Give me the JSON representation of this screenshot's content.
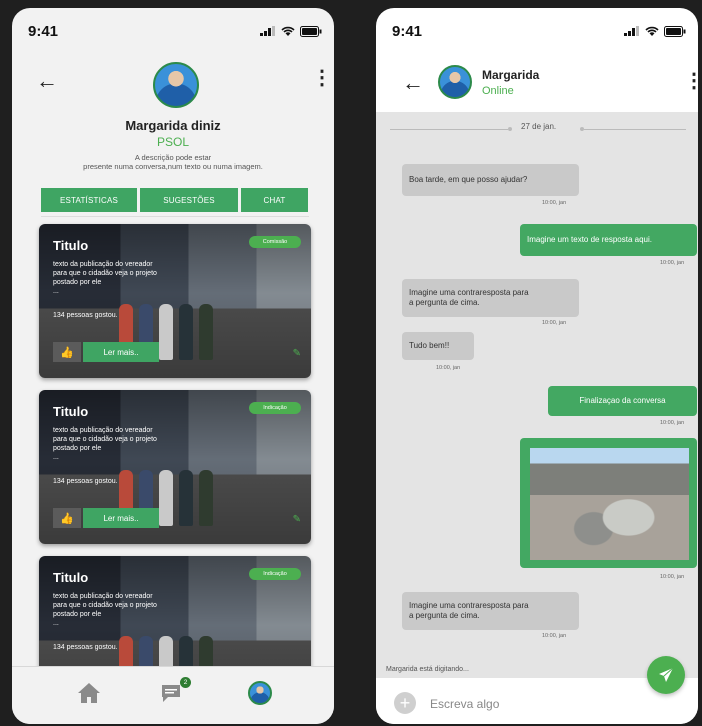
{
  "status_bar": {
    "time": "9:41"
  },
  "profile": {
    "name": "Margarida diniz",
    "party": "PSOL",
    "description_line1": "A descrição pode estar",
    "description_line2": "presente numa conversa,num texto ou numa imagem."
  },
  "tabs": [
    {
      "label": "ESTATÍSTICAS"
    },
    {
      "label": "SUGESTÕES"
    },
    {
      "label": "CHAT"
    }
  ],
  "posts": [
    {
      "title": "Titulo",
      "text_line1": "texto da publicação do vereador",
      "text_line2": "para que o cidadão veja o projeto",
      "text_line3": "postado por ele",
      "text_line4": "...",
      "likes": "134 pessoas gostou.",
      "badge": "Comissão",
      "button": "Ler mais.."
    },
    {
      "title": "Titulo",
      "text_line1": "texto da publicação do vereador",
      "text_line2": "para que o cidadão veja o projeto",
      "text_line3": "postado por ele",
      "text_line4": "...",
      "likes": "134 pessoas gostou.",
      "badge": "Indicação",
      "button": "Ler mais.."
    },
    {
      "title": "Titulo",
      "text_line1": "texto da publicação do vereador",
      "text_line2": "para que o cidadão veja o projeto",
      "text_line3": "postado por ele",
      "text_line4": "...",
      "likes": "134 pessoas gostou.",
      "badge": "Indicação",
      "button": ""
    }
  ],
  "nav": {
    "chat_badge": "2"
  },
  "chat": {
    "contact_name": "Margarida",
    "contact_status": "Online",
    "date": "27 de jan.",
    "messages": [
      {
        "text": "Boa tarde, em que posso ajudar?",
        "time": "10:00, jan"
      },
      {
        "text": "Imagine um texto de resposta aqui.",
        "time": "10:00, jan"
      },
      {
        "text_line1": "Imagine uma contraresposta para",
        "text_line2": "a pergunta de cima.",
        "time": "10:00, jan"
      },
      {
        "text": "Tudo bem!!",
        "time": "10:00, jan"
      },
      {
        "text": "Finalizaçao da conversa",
        "time": "10:00, jan"
      },
      {
        "text": "",
        "time": "10:00, jan"
      },
      {
        "text_line1": "Imagine uma contraresposta para",
        "text_line2": "a pergunta de cima.",
        "time": "10:00, jan"
      }
    ],
    "typing_indicator": "Margarida está digitando...",
    "input_placeholder": "Escreva algo"
  },
  "colors": {
    "accent_green": "#4caf50",
    "button_green": "#3fa563",
    "bubble_gray": "#c9c9c9",
    "chat_bg": "#e4e4e4"
  },
  "icons": [
    "back-arrow-icon",
    "kebab-menu-icon",
    "thumbs-up-icon",
    "pencil-icon",
    "home-icon",
    "chat-icon",
    "send-icon",
    "plus-icon",
    "signal-icon",
    "wifi-icon",
    "battery-icon"
  ]
}
